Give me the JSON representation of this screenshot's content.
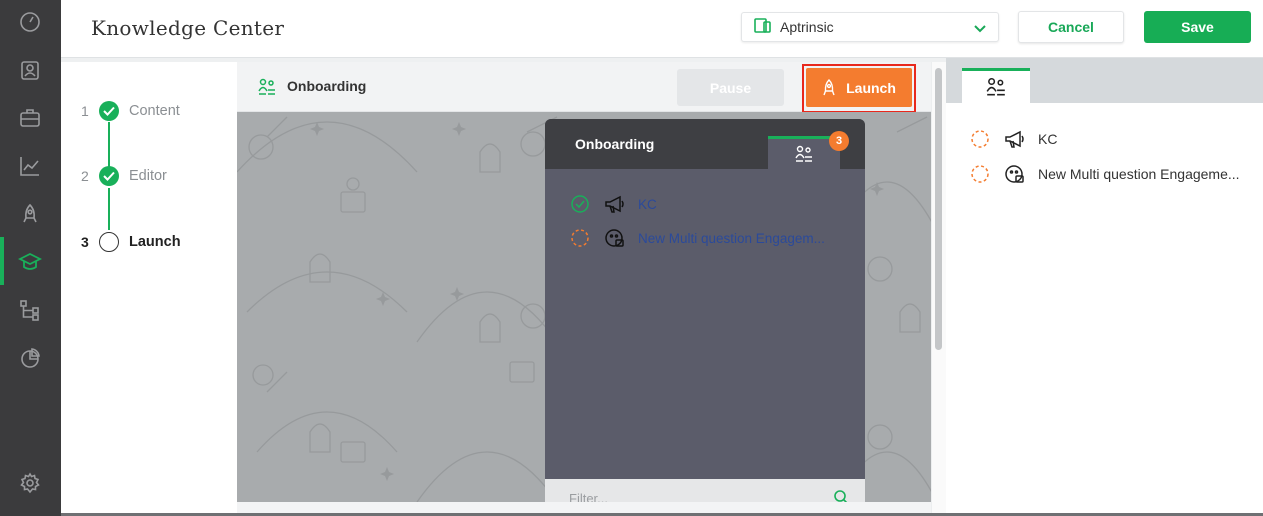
{
  "header": {
    "title": "Knowledge Center",
    "app_selector": {
      "selected": "Aptrinsic"
    },
    "cancel_label": "Cancel",
    "save_label": "Save"
  },
  "rail": {
    "items": [
      "speedometer-icon",
      "user-card-icon",
      "briefcase-icon",
      "analytics-chart-icon",
      "rocket-icon",
      "graduation-cap-icon",
      "flow-tree-icon",
      "pie-chart-icon"
    ],
    "active": "graduation-cap-icon",
    "bottom": "settings-gear-icon",
    "active_color": "#19b05a"
  },
  "steps": [
    {
      "number": "1",
      "label": "Content",
      "state": "done"
    },
    {
      "number": "2",
      "label": "Editor",
      "state": "done"
    },
    {
      "number": "3",
      "label": "Launch",
      "state": "current"
    }
  ],
  "preview": {
    "title": "Onboarding",
    "pause_label": "Pause",
    "launch_label": "Launch"
  },
  "widget": {
    "title": "Onboarding",
    "badge_count": "3",
    "items": [
      {
        "label": "KC",
        "status": "complete"
      },
      {
        "label": "New Multi question Engagem...",
        "status": "pending"
      }
    ],
    "filter_placeholder": "Filter..."
  },
  "right_panel": {
    "items": [
      {
        "label": "KC"
      },
      {
        "label": "New Multi question Engageme..."
      }
    ]
  },
  "colors": {
    "brand_green": "#19b05a",
    "launch_orange": "#f47c2f",
    "highlight_red": "#e8281c"
  }
}
